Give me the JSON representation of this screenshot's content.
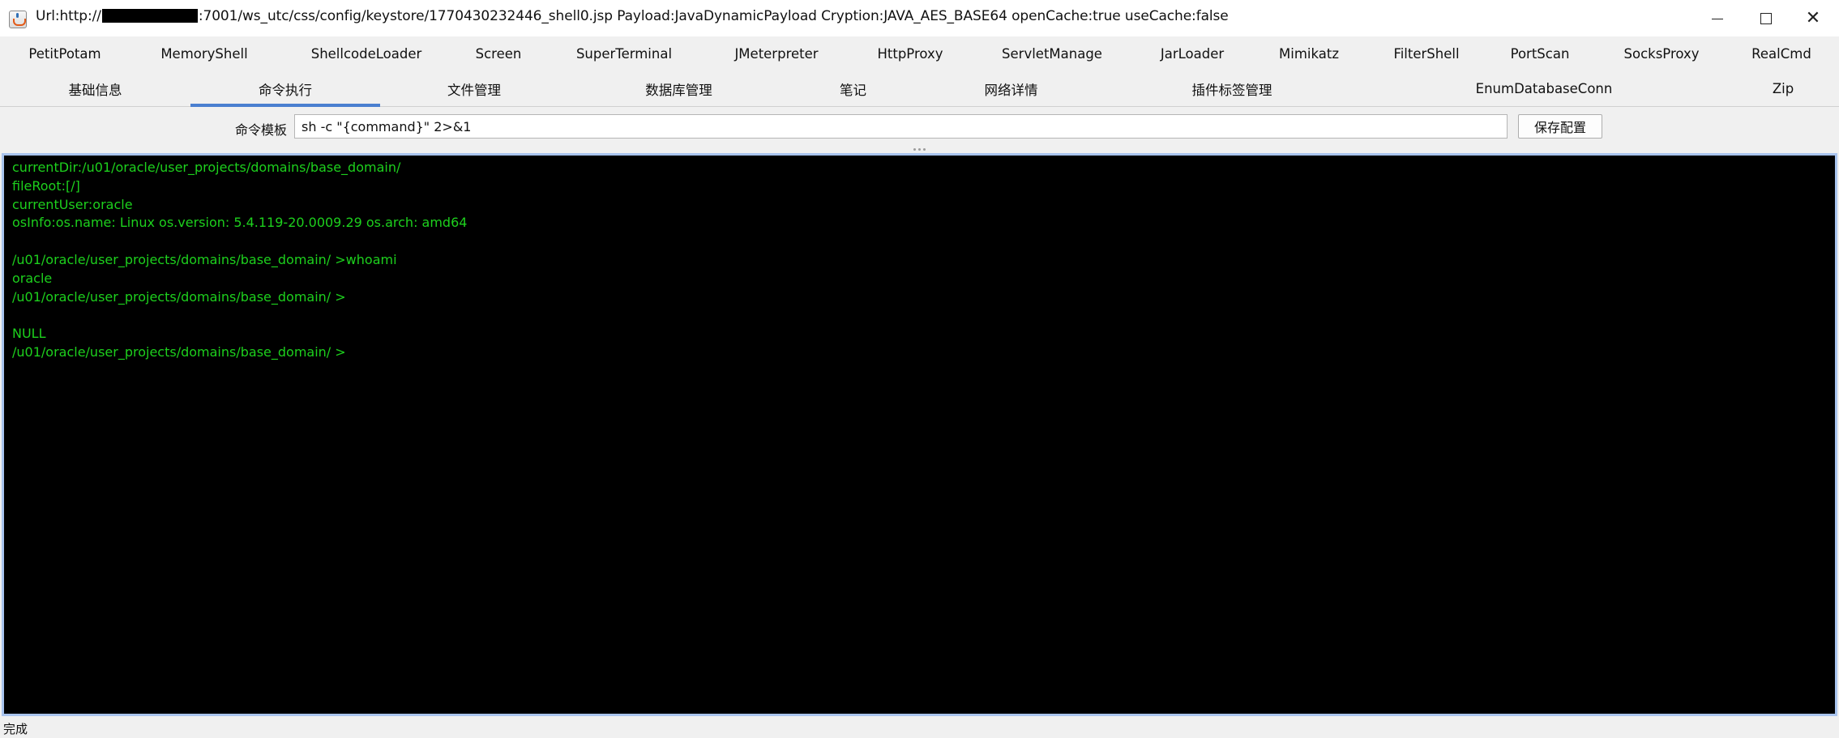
{
  "window": {
    "title_prefix": "Url:http://",
    "title_suffix": ":7001/ws_utc/css/config/keystore/1770430232446_shell0.jsp Payload:JavaDynamicPayload Cryption:JAVA_AES_BASE64 openCache:true useCache:false",
    "minimize_icon": "minimize-icon",
    "maximize_icon": "maximize-icon",
    "close_icon": "close-icon"
  },
  "plugin_tabs": [
    {
      "label": "PetitPotam"
    },
    {
      "label": "MemoryShell"
    },
    {
      "label": "ShellcodeLoader"
    },
    {
      "label": "Screen"
    },
    {
      "label": "SuperTerminal"
    },
    {
      "label": "JMeterpreter"
    },
    {
      "label": "HttpProxy"
    },
    {
      "label": "ServletManage"
    },
    {
      "label": "JarLoader"
    },
    {
      "label": "Mimikatz"
    },
    {
      "label": "FilterShell"
    },
    {
      "label": "PortScan"
    },
    {
      "label": "SocksProxy"
    },
    {
      "label": "RealCmd"
    }
  ],
  "main_tabs": [
    {
      "label": "基础信息",
      "active": false
    },
    {
      "label": "命令执行",
      "active": true
    },
    {
      "label": "文件管理",
      "active": false
    },
    {
      "label": "数据库管理",
      "active": false
    },
    {
      "label": "笔记",
      "active": false
    },
    {
      "label": "网络详情",
      "active": false
    },
    {
      "label": "插件标签管理",
      "active": false
    },
    {
      "label": "EnumDatabaseConn",
      "active": false
    },
    {
      "label": "Zip",
      "active": false
    }
  ],
  "command_template": {
    "label": "命令模板",
    "value": "sh -c \"{command}\" 2>&1",
    "save_label": "保存配置"
  },
  "terminal": {
    "text_color": "#1dd01d",
    "background": "#000000",
    "lines": [
      "currentDir:/u01/oracle/user_projects/domains/base_domain/",
      "fileRoot:[/]",
      "currentUser:oracle",
      "osInfo:os.name: Linux os.version: 5.4.119-20.0009.29 os.arch: amd64",
      "",
      "/u01/oracle/user_projects/domains/base_domain/ >whoami",
      "oracle",
      "/u01/oracle/user_projects/domains/base_domain/ >",
      "",
      "NULL",
      "/u01/oracle/user_projects/domains/base_domain/ >"
    ]
  },
  "status": {
    "text": "完成"
  },
  "colors": {
    "active_tab_indicator": "#4a7fd0",
    "terminal_border": "#a9c4ee"
  }
}
